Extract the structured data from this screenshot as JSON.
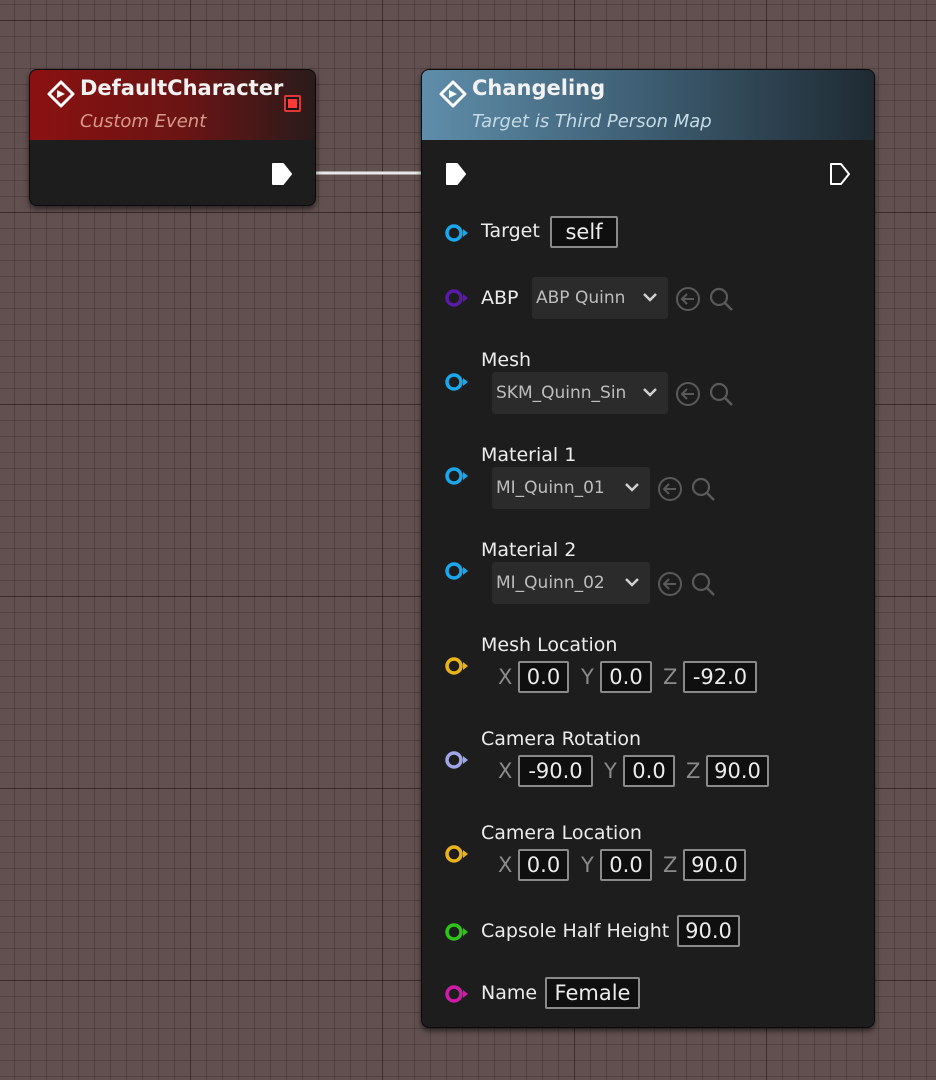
{
  "event_node": {
    "title": "DefaultCharacter",
    "subtitle": "Custom Event",
    "header_color": "#8b1111",
    "badge_color": "#ff3a3a"
  },
  "function_node": {
    "title": "Changeling",
    "subtitle": "Target is Third Person Map",
    "header_color": "#5f8daa",
    "pins": {
      "target": {
        "label": "Target",
        "value": "self",
        "color": "#1aa7ec"
      },
      "abp": {
        "label": "ABP",
        "value": "ABP Quinn",
        "color": "#5a1aa8"
      },
      "mesh": {
        "label": "Mesh",
        "value": "SKM_Quinn_Sin",
        "color": "#1aa7ec"
      },
      "material1": {
        "label": "Material 1",
        "value": "MI_Quinn_01",
        "color": "#1aa7ec"
      },
      "material2": {
        "label": "Material 2",
        "value": "MI_Quinn_02",
        "color": "#1aa7ec"
      },
      "mesh_location": {
        "label": "Mesh Location",
        "x": "0.0",
        "y": "0.0",
        "z": "-92.0",
        "color": "#e8b41a"
      },
      "camera_rotation": {
        "label": "Camera Rotation",
        "x": "-90.0",
        "y": "0.0",
        "z": "90.0",
        "color": "#9fa5e6"
      },
      "camera_location": {
        "label": "Camera Location",
        "x": "0.0",
        "y": "0.0",
        "z": "90.0",
        "color": "#e8b41a"
      },
      "capsule_half_height": {
        "label": "Capsole Half Height",
        "value": "90.0",
        "color": "#2ec41a"
      },
      "name": {
        "label": "Name",
        "value": "Female",
        "color": "#d01aa8"
      }
    }
  },
  "axis_labels": {
    "x": "X",
    "y": "Y",
    "z": "Z"
  },
  "icons": {
    "node": "function-diamond-icon",
    "exec": "exec-pin-icon",
    "use_selected": "use-selected-asset-icon",
    "browse": "browse-search-icon",
    "dropdown": "chevron-down-icon"
  }
}
